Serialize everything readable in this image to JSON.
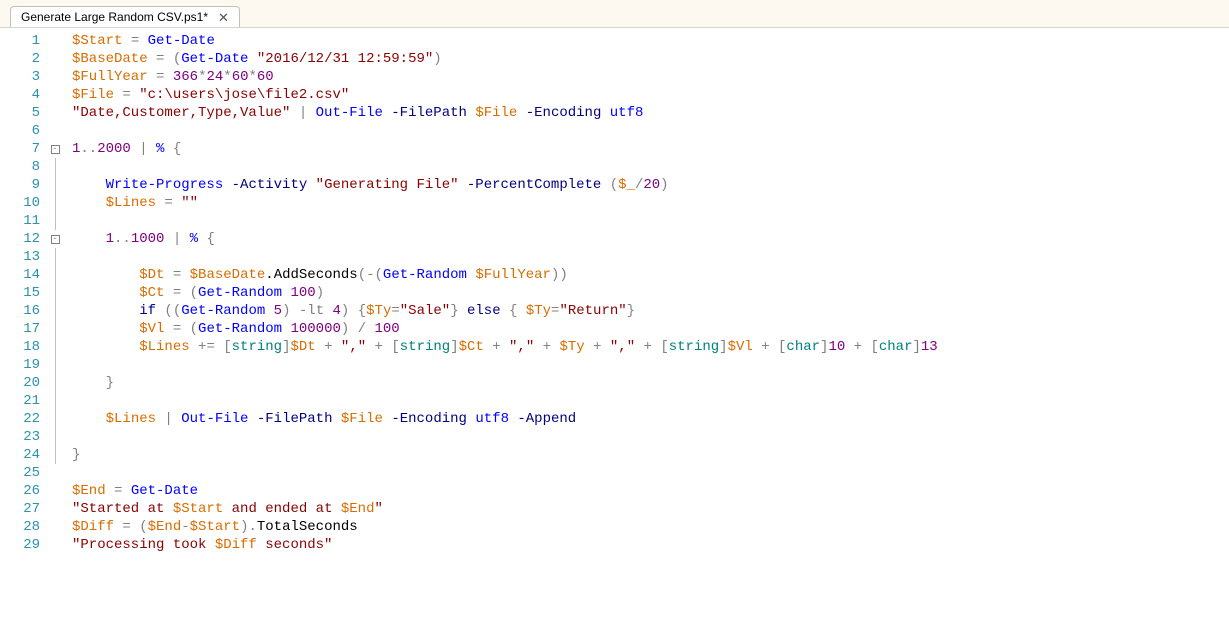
{
  "tab": {
    "title": "Generate Large Random CSV.ps1*",
    "close": "✕"
  },
  "code": {
    "lines": [
      {
        "n": 1,
        "fold": ""
      },
      {
        "n": 2,
        "fold": ""
      },
      {
        "n": 3,
        "fold": ""
      },
      {
        "n": 4,
        "fold": ""
      },
      {
        "n": 5,
        "fold": ""
      },
      {
        "n": 6,
        "fold": ""
      },
      {
        "n": 7,
        "fold": "box"
      },
      {
        "n": 8,
        "fold": "ln"
      },
      {
        "n": 9,
        "fold": "ln"
      },
      {
        "n": 10,
        "fold": "ln"
      },
      {
        "n": 11,
        "fold": "ln"
      },
      {
        "n": 12,
        "fold": "box"
      },
      {
        "n": 13,
        "fold": "ln"
      },
      {
        "n": 14,
        "fold": "ln"
      },
      {
        "n": 15,
        "fold": "ln"
      },
      {
        "n": 16,
        "fold": "ln"
      },
      {
        "n": 17,
        "fold": "ln"
      },
      {
        "n": 18,
        "fold": "ln"
      },
      {
        "n": 19,
        "fold": "ln"
      },
      {
        "n": 20,
        "fold": "ln"
      },
      {
        "n": 21,
        "fold": "ln"
      },
      {
        "n": 22,
        "fold": "ln"
      },
      {
        "n": 23,
        "fold": "ln"
      },
      {
        "n": 24,
        "fold": "ln"
      },
      {
        "n": 25,
        "fold": ""
      },
      {
        "n": 26,
        "fold": ""
      },
      {
        "n": 27,
        "fold": ""
      },
      {
        "n": 28,
        "fold": ""
      },
      {
        "n": 29,
        "fold": ""
      }
    ],
    "tokens": {
      "l1": {
        "v1": "$Start",
        "op1": " = ",
        "cmd1": "Get-Date"
      },
      "l2": {
        "v1": "$BaseDate",
        "op1": " = (",
        "cmd1": "Get-Date",
        "sp": " ",
        "str1": "\"2016/12/31 12:59:59\"",
        "op2": ")"
      },
      "l3": {
        "v1": "$FullYear",
        "op1": " = ",
        "n1": "366",
        "op2": "*",
        "n2": "24",
        "op3": "*",
        "n3": "60",
        "op4": "*",
        "n4": "60"
      },
      "l4": {
        "v1": "$File",
        "op1": " = ",
        "str1": "\"c:\\users\\jose\\file2.csv\""
      },
      "l5": {
        "str1": "\"Date,Customer,Type,Value\"",
        "op1": " | ",
        "cmd1": "Out-File",
        "sp1": " ",
        "p1": "-FilePath",
        "sp2": " ",
        "v1": "$File",
        "sp3": " ",
        "p2": "-Encoding",
        "sp4": " ",
        "a1": "utf8"
      },
      "l7": {
        "n1": "1",
        "op1": "..",
        "n2": "2000",
        "op2": " | ",
        "cmd1": "%",
        "op3": " {"
      },
      "l9": {
        "cmd1": "Write-Progress",
        "sp1": " ",
        "p1": "-Activity",
        "sp2": " ",
        "str1": "\"Generating File\"",
        "sp3": " ",
        "p2": "-PercentComplete",
        "sp4": " (",
        "v1": "$_",
        "op1": "/",
        "n1": "20",
        "op2": ")"
      },
      "l10": {
        "v1": "$Lines",
        "op1": " = ",
        "str1": "\"\""
      },
      "l12": {
        "n1": "1",
        "op1": "..",
        "n2": "1000",
        "op2": " | ",
        "cmd1": "%",
        "op3": " {"
      },
      "l14": {
        "v1": "$Dt",
        "op1": " = ",
        "v2": "$BaseDate",
        "dot": ".",
        "m1": "AddSeconds",
        "op2": "(-(",
        "cmd1": "Get-Random",
        "sp": " ",
        "v3": "$FullYear",
        "op3": "))"
      },
      "l15": {
        "v1": "$Ct",
        "op1": " = (",
        "cmd1": "Get-Random",
        "sp": " ",
        "n1": "100",
        "op2": ")"
      },
      "l16": {
        "kw1": "if",
        "op1": " ((",
        "cmd1": "Get-Random",
        "sp": " ",
        "n1": "5",
        "op2": ") ",
        "p1": "-lt",
        "sp2": " ",
        "n2": "4",
        "op3": ") {",
        "v1": "$Ty",
        "op4": "=",
        "str1": "\"Sale\"",
        "op5": "} ",
        "kw2": "else",
        "op6": " { ",
        "v2": "$Ty",
        "op7": "=",
        "str2": "\"Return\"",
        "op8": "}"
      },
      "l17": {
        "v1": "$Vl",
        "op1": " = (",
        "cmd1": "Get-Random",
        "sp": " ",
        "n1": "100000",
        "op2": ") / ",
        "n2": "100"
      },
      "l18": {
        "v1": "$Lines",
        "op1": " += ",
        "t1": "[",
        "ty1": "string",
        "t2": "]",
        "v2": "$Dt",
        "op2": " + ",
        "str1": "\",\"",
        "op3": " + ",
        "t3": "[",
        "ty2": "string",
        "t4": "]",
        "v3": "$Ct",
        "op4": " + ",
        "str2": "\",\"",
        "op5": " + ",
        "v4": "$Ty",
        "op6": " + ",
        "str3": "\",\"",
        "op7": " + ",
        "t5": "[",
        "ty3": "string",
        "t6": "]",
        "v5": "$Vl",
        "op8": " + ",
        "t7": "[",
        "ty4": "char",
        "t8": "]",
        "n1": "10",
        "op9": " + ",
        "t9": "[",
        "ty5": "char",
        "t10": "]",
        "n2": "13"
      },
      "l20": {
        "op1": "}"
      },
      "l22": {
        "v1": "$Lines",
        "op1": " | ",
        "cmd1": "Out-File",
        "sp1": " ",
        "p1": "-FilePath",
        "sp2": " ",
        "v2": "$File",
        "sp3": " ",
        "p2": "-Encoding",
        "sp4": " ",
        "a1": "utf8",
        "sp5": " ",
        "p3": "-Append"
      },
      "l24": {
        "op1": "}"
      },
      "l26": {
        "v1": "$End",
        "op1": " = ",
        "cmd1": "Get-Date"
      },
      "l27": {
        "s1": "\"Started at ",
        "v1": "$Start",
        "s2": " and ended at ",
        "v2": "$End",
        "s3": "\""
      },
      "l28": {
        "v1": "$Diff",
        "op1": " = (",
        "v2": "$End",
        "op2": "-",
        "v3": "$Start",
        "op3": ").",
        "m1": "TotalSeconds"
      },
      "l29": {
        "s1": "\"Processing took ",
        "v1": "$Diff",
        "s2": " seconds\""
      }
    },
    "foldGlyph": "⊟"
  }
}
